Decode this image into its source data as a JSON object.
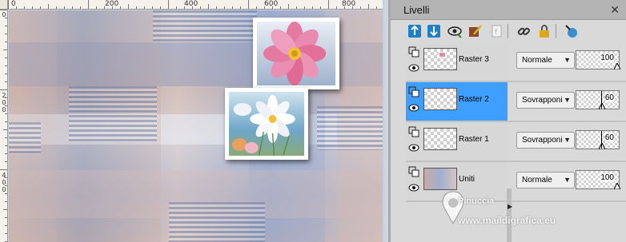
{
  "ruler": {
    "top_labels": [
      "0",
      "200",
      "400",
      "600",
      "800"
    ],
    "left_labels": [
      [
        "0"
      ],
      [
        "2",
        "0",
        "0"
      ],
      [
        "4",
        "0",
        "0"
      ]
    ]
  },
  "panel": {
    "title": "Livelli",
    "toolbar_icons": [
      "new-raster-layer-icon",
      "new-vector-layer-icon",
      "visibility-toggle-icon",
      "edit-mask-icon",
      "group-layer-icon",
      "link-icon",
      "lock-icon",
      "delete-layer-icon"
    ]
  },
  "layers": [
    {
      "name": "Raster 3",
      "blend_mode": "Normale",
      "opacity": "100",
      "opacity_level": 100,
      "selected": false
    },
    {
      "name": "Raster 2",
      "blend_mode": "Sovrapponi",
      "opacity": "60",
      "opacity_level": 60,
      "selected": true
    },
    {
      "name": "Raster 1",
      "blend_mode": "Sovrapponi",
      "opacity": "60",
      "opacity_level": 60,
      "selected": false
    },
    {
      "name": "Uniti",
      "blend_mode": "Normale",
      "opacity": "100",
      "opacity_level": 100,
      "selected": false
    }
  ],
  "watermark": {
    "line1": "Pinuccia",
    "line2": "www.maildigrafica.eu"
  },
  "colors": {
    "selection": "#3f9fff",
    "panel_bg": "#d9d9d9",
    "titlebar": "#b4b4b4"
  }
}
